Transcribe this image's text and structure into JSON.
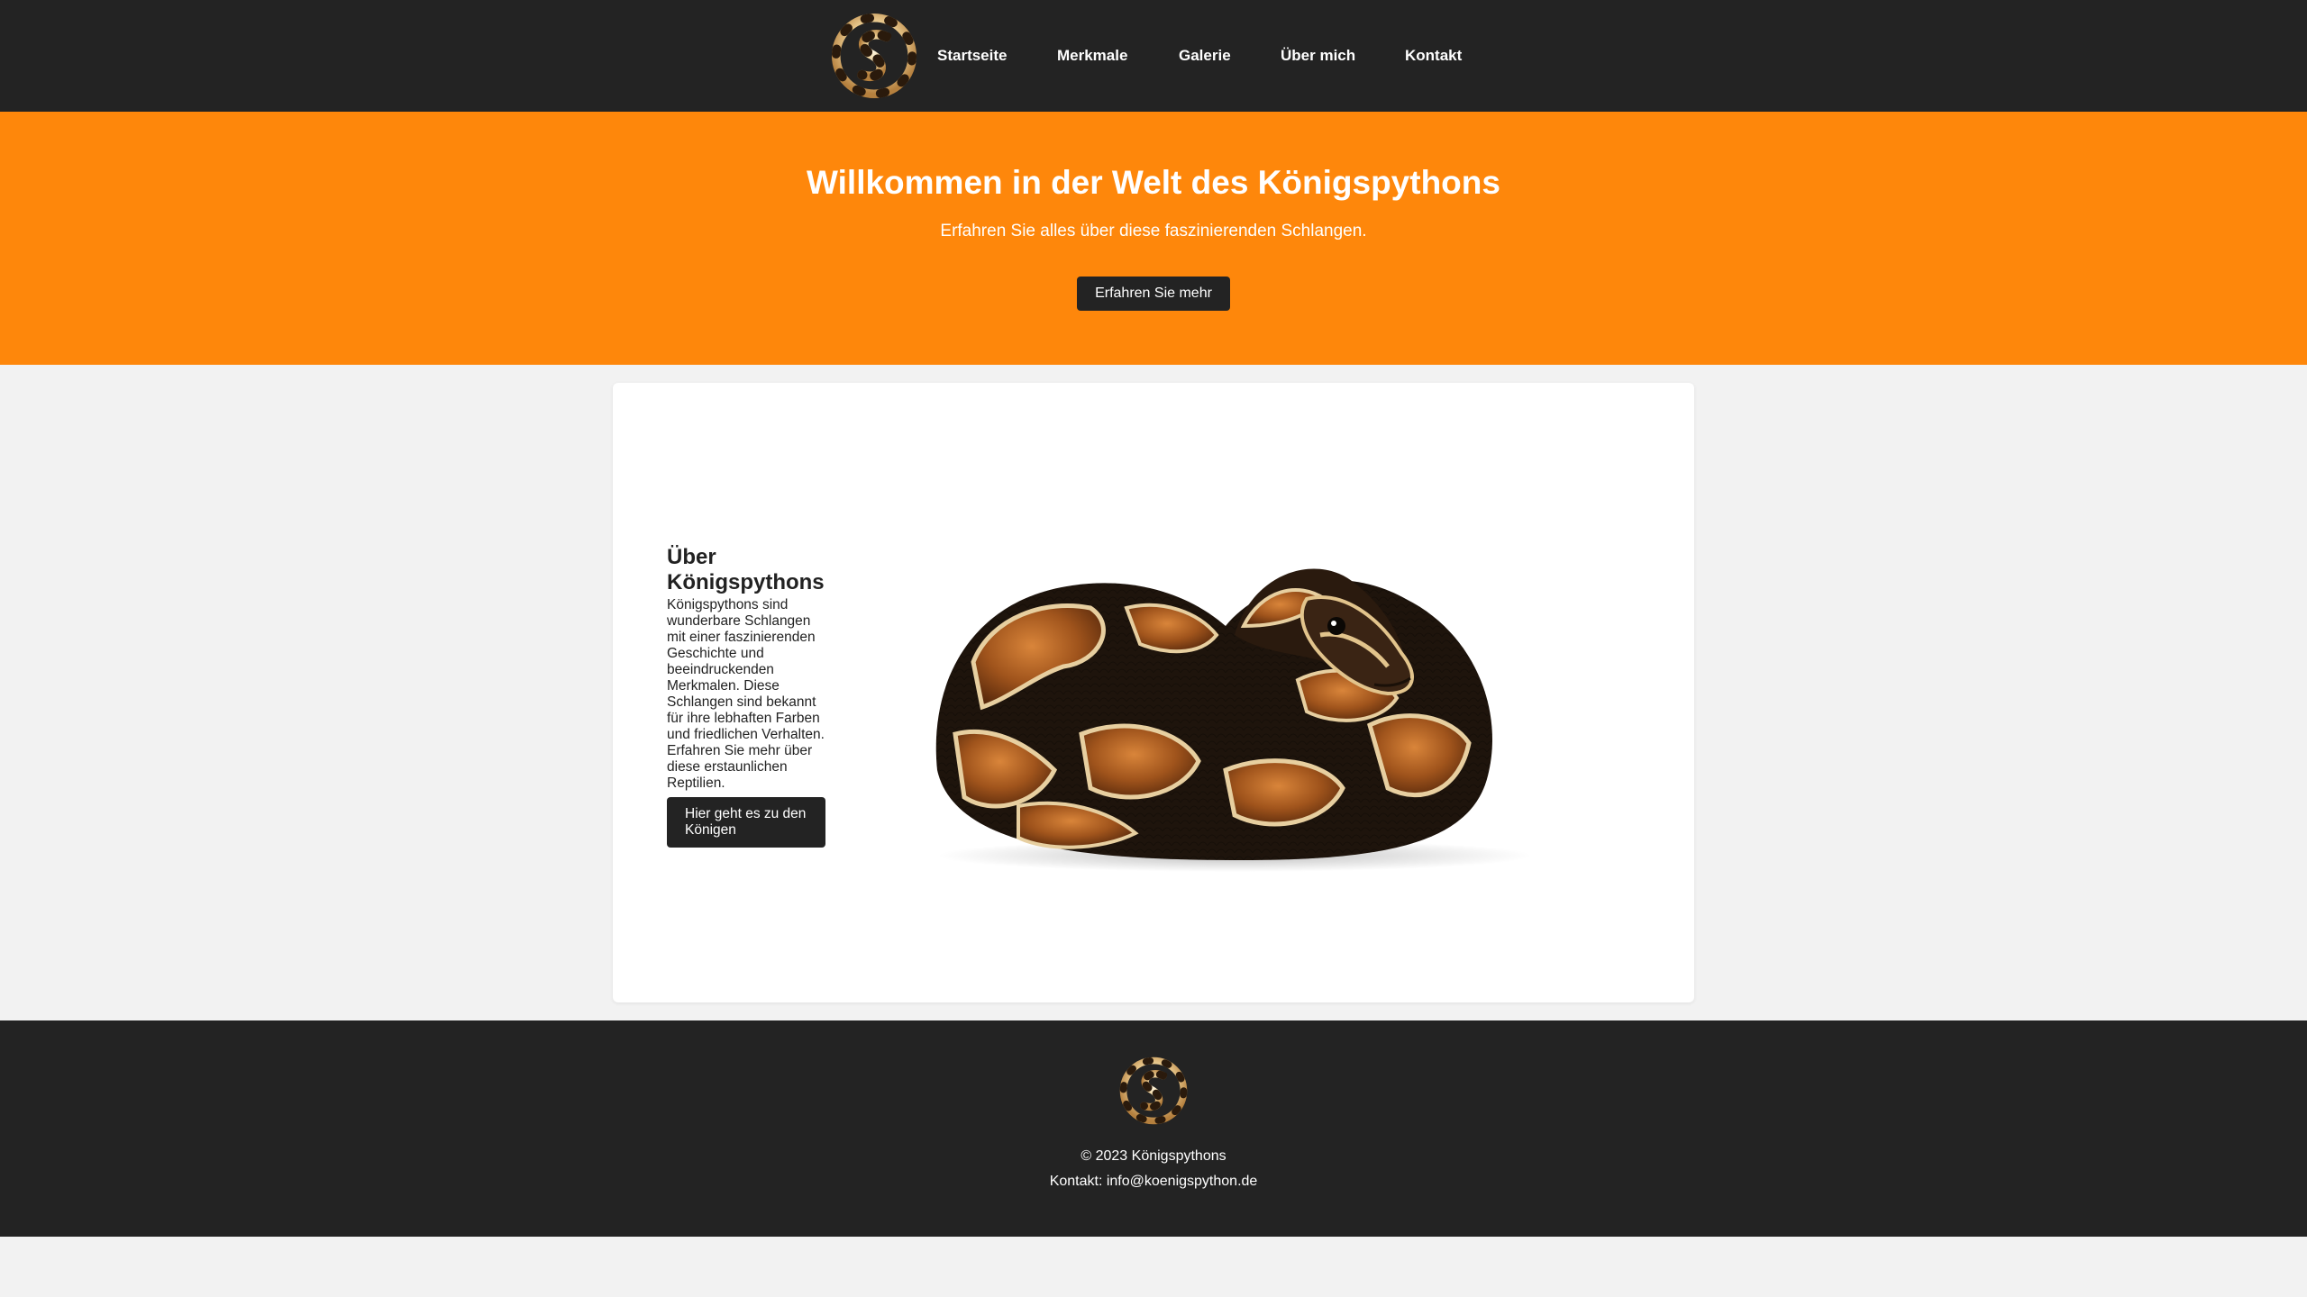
{
  "header": {
    "logo_icon": "python-logo-icon",
    "nav": [
      "Startseite",
      "Merkmale",
      "Galerie",
      "Über mich",
      "Kontakt"
    ]
  },
  "hero": {
    "title": "Willkommen in der Welt des Königspythons",
    "subtitle": "Erfahren Sie alles über diese faszinierenden Schlangen.",
    "button": "Erfahren Sie mehr"
  },
  "about": {
    "title": "Über Königspythons",
    "text": "Königspythons sind wunderbare Schlangen mit einer faszinierenden Geschichte und beeindruckenden Merkmalen. Diese Schlangen sind bekannt für ihre lebhaften Farben und friedlichen Verhalten. Erfahren Sie mehr über diese erstaunlichen Reptilien.",
    "button": "Hier geht es zu den Königen",
    "image": "ball-python-image"
  },
  "footer": {
    "copyright": "© 2023 Königspythons",
    "contact": "Kontakt: info@koenigspython.de"
  },
  "colors": {
    "header_bg": "#232323",
    "hero_bg": "#fe870b",
    "page_bg": "#f2f2f2",
    "button_bg": "#232323"
  }
}
